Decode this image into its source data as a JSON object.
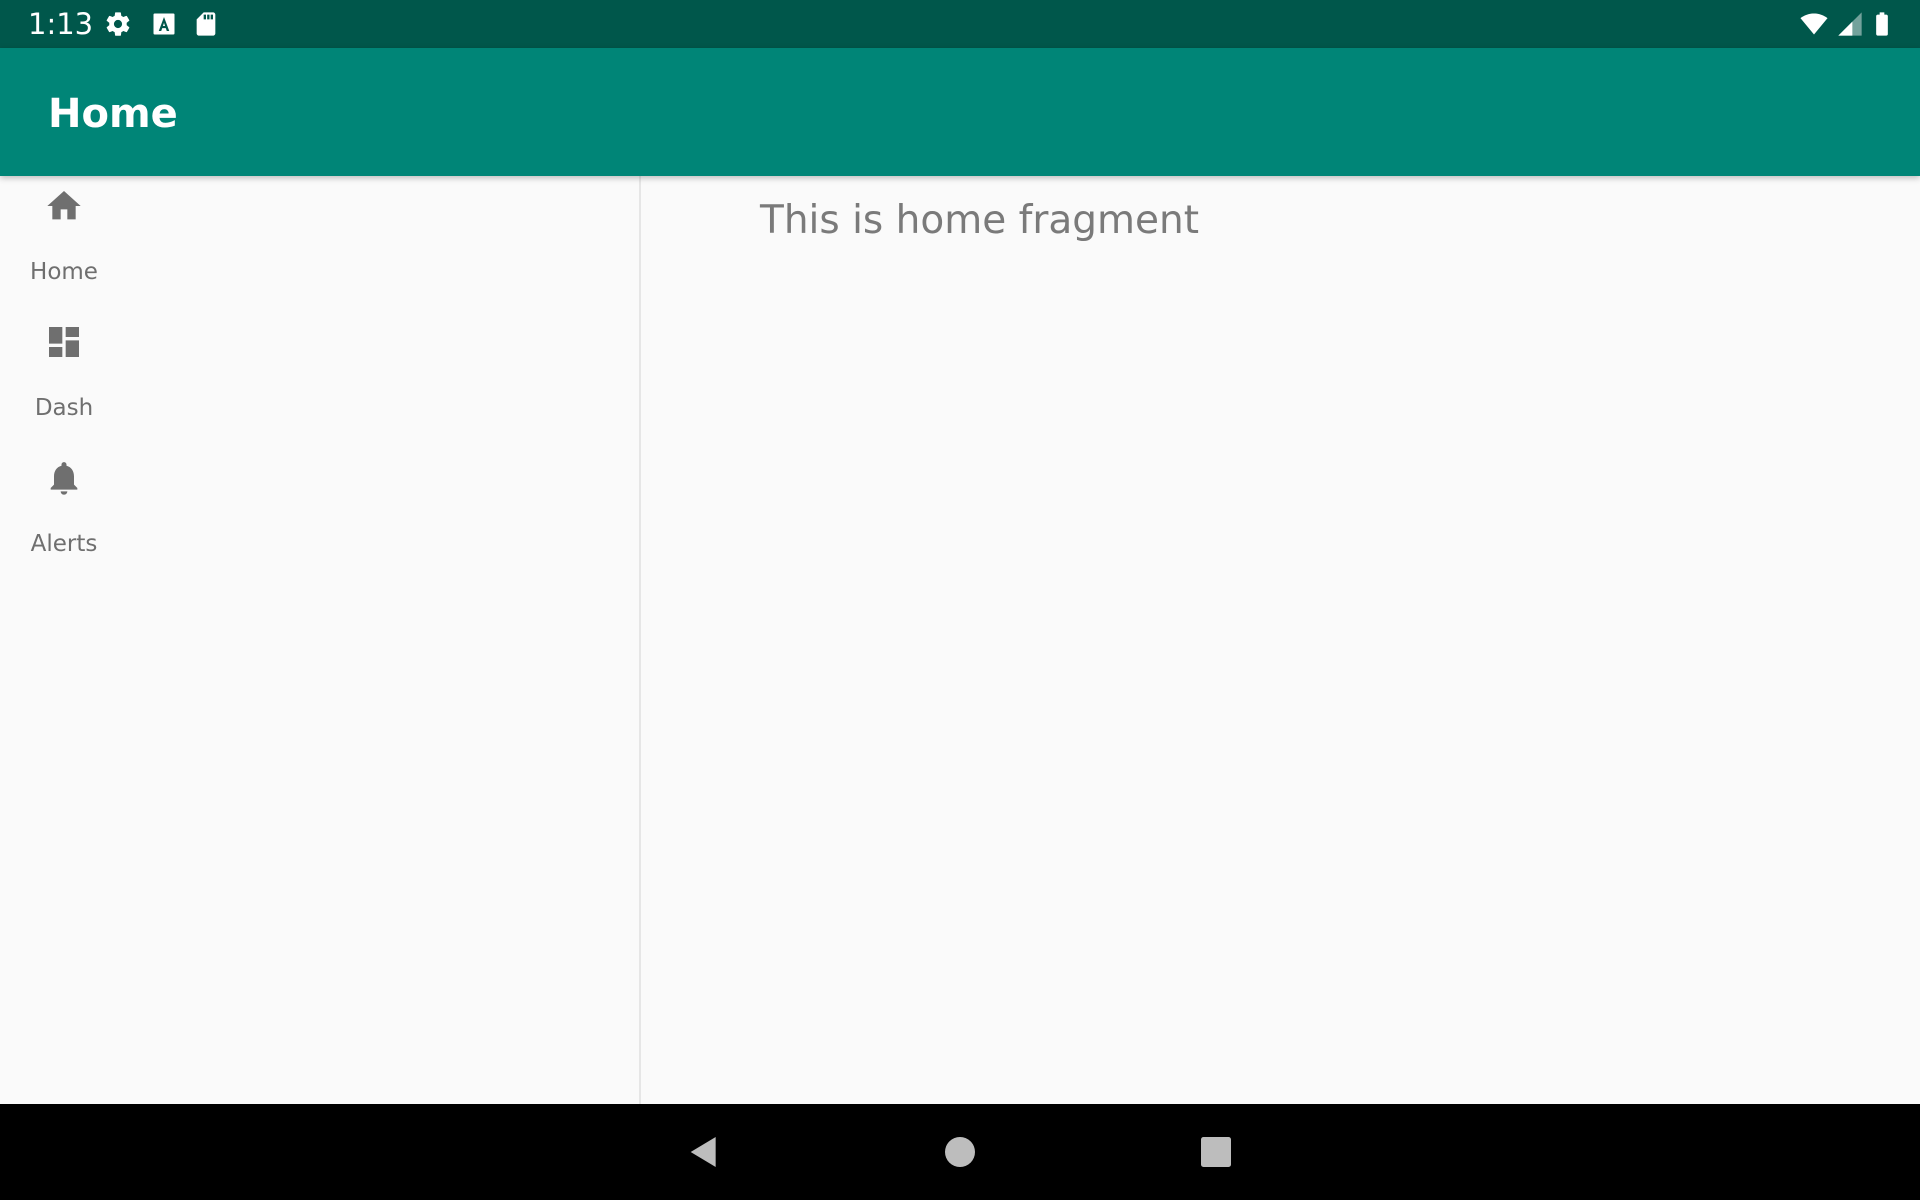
{
  "status_bar": {
    "time": "1:13",
    "left_icons": [
      "settings-icon",
      "a-box-icon",
      "sd-card-icon"
    ],
    "right_icons": [
      "wifi-icon",
      "signal-icon",
      "battery-icon"
    ],
    "color": "#00574b"
  },
  "app_bar": {
    "title": "Home",
    "color": "#008577"
  },
  "nav_rail": {
    "items": [
      {
        "label": "Home",
        "icon": "home-icon"
      },
      {
        "label": "Dash",
        "icon": "dashboard-icon"
      },
      {
        "label": "Alerts",
        "icon": "bell-icon"
      }
    ]
  },
  "content": {
    "text": "This is home fragment"
  },
  "system_nav": {
    "buttons": [
      "back-icon",
      "home-circle-icon",
      "recents-icon"
    ]
  }
}
